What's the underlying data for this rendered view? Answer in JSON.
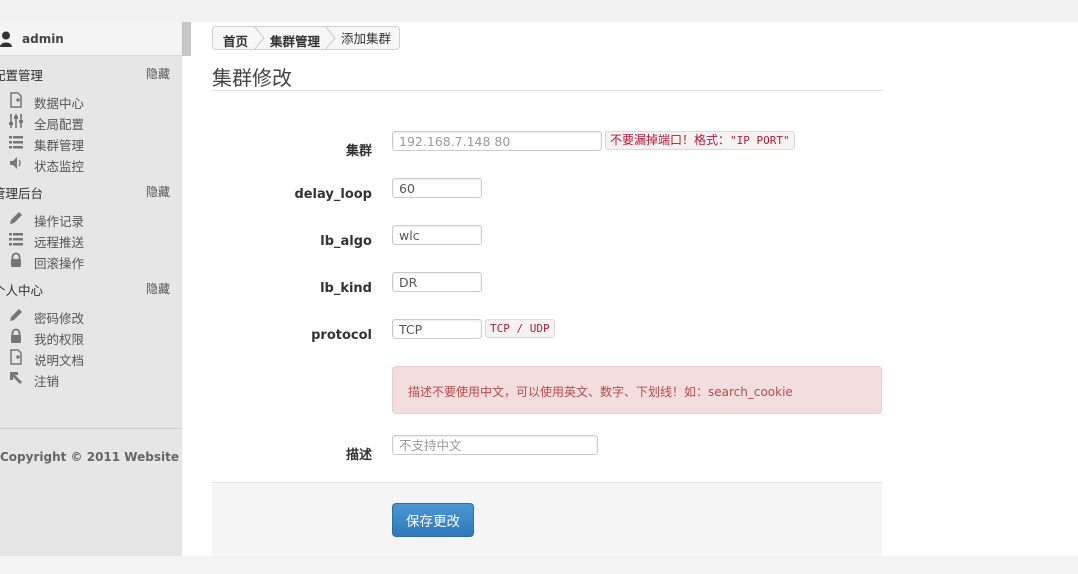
{
  "sidebar": {
    "user_name": "admin",
    "sections": [
      {
        "title": "配置管理",
        "hide_label": "隐藏",
        "items": [
          {
            "label": "数据中心",
            "icon": "file-add-icon"
          },
          {
            "label": "全局配置",
            "icon": "sliders-icon"
          },
          {
            "label": "集群管理",
            "icon": "list-icon"
          },
          {
            "label": "状态监控",
            "icon": "volume-icon"
          }
        ]
      },
      {
        "title": "管理后台",
        "hide_label": "隐藏",
        "items": [
          {
            "label": "操作记录",
            "icon": "pencil-icon"
          },
          {
            "label": "远程推送",
            "icon": "list-icon"
          },
          {
            "label": "回滚操作",
            "icon": "lock-icon"
          }
        ]
      },
      {
        "title": "个人中心",
        "hide_label": "隐藏",
        "items": [
          {
            "label": "密码修改",
            "icon": "pencil-icon"
          },
          {
            "label": "我的权限",
            "icon": "lock-icon"
          },
          {
            "label": "说明文档",
            "icon": "file-add-icon"
          },
          {
            "label": "注销",
            "icon": "arrow-up-left-icon"
          }
        ]
      }
    ],
    "copyright": "Copyright © 2011 Website"
  },
  "breadcrumb": [
    "首页",
    "集群管理",
    "添加集群"
  ],
  "page_title": "集群修改",
  "form": {
    "cluster": {
      "label": "集群",
      "placeholder": "192.168.7.148 80",
      "help_cn": "不要漏掉端口！格式：",
      "help_code": "\"IP PORT\""
    },
    "delay_loop": {
      "label": "delay_loop",
      "value": "60"
    },
    "lb_algo": {
      "label": "lb_algo",
      "value": "wlc"
    },
    "lb_kind": {
      "label": "lb_kind",
      "value": "DR"
    },
    "protocol": {
      "label": "protocol",
      "value": "TCP",
      "help_code": "TCP / UDP"
    },
    "alert_text": "描述不要使用中文，可以使用英文、数字、下划线！如：search_cookie",
    "description": {
      "label": "描述",
      "placeholder": "不支持中文"
    },
    "save_label": "保存更改"
  },
  "colors": {
    "primary_button": "#3a87c8",
    "alert_bg": "#f2dede",
    "alert_text": "#b94a48",
    "help_text": "#b01a3a"
  }
}
